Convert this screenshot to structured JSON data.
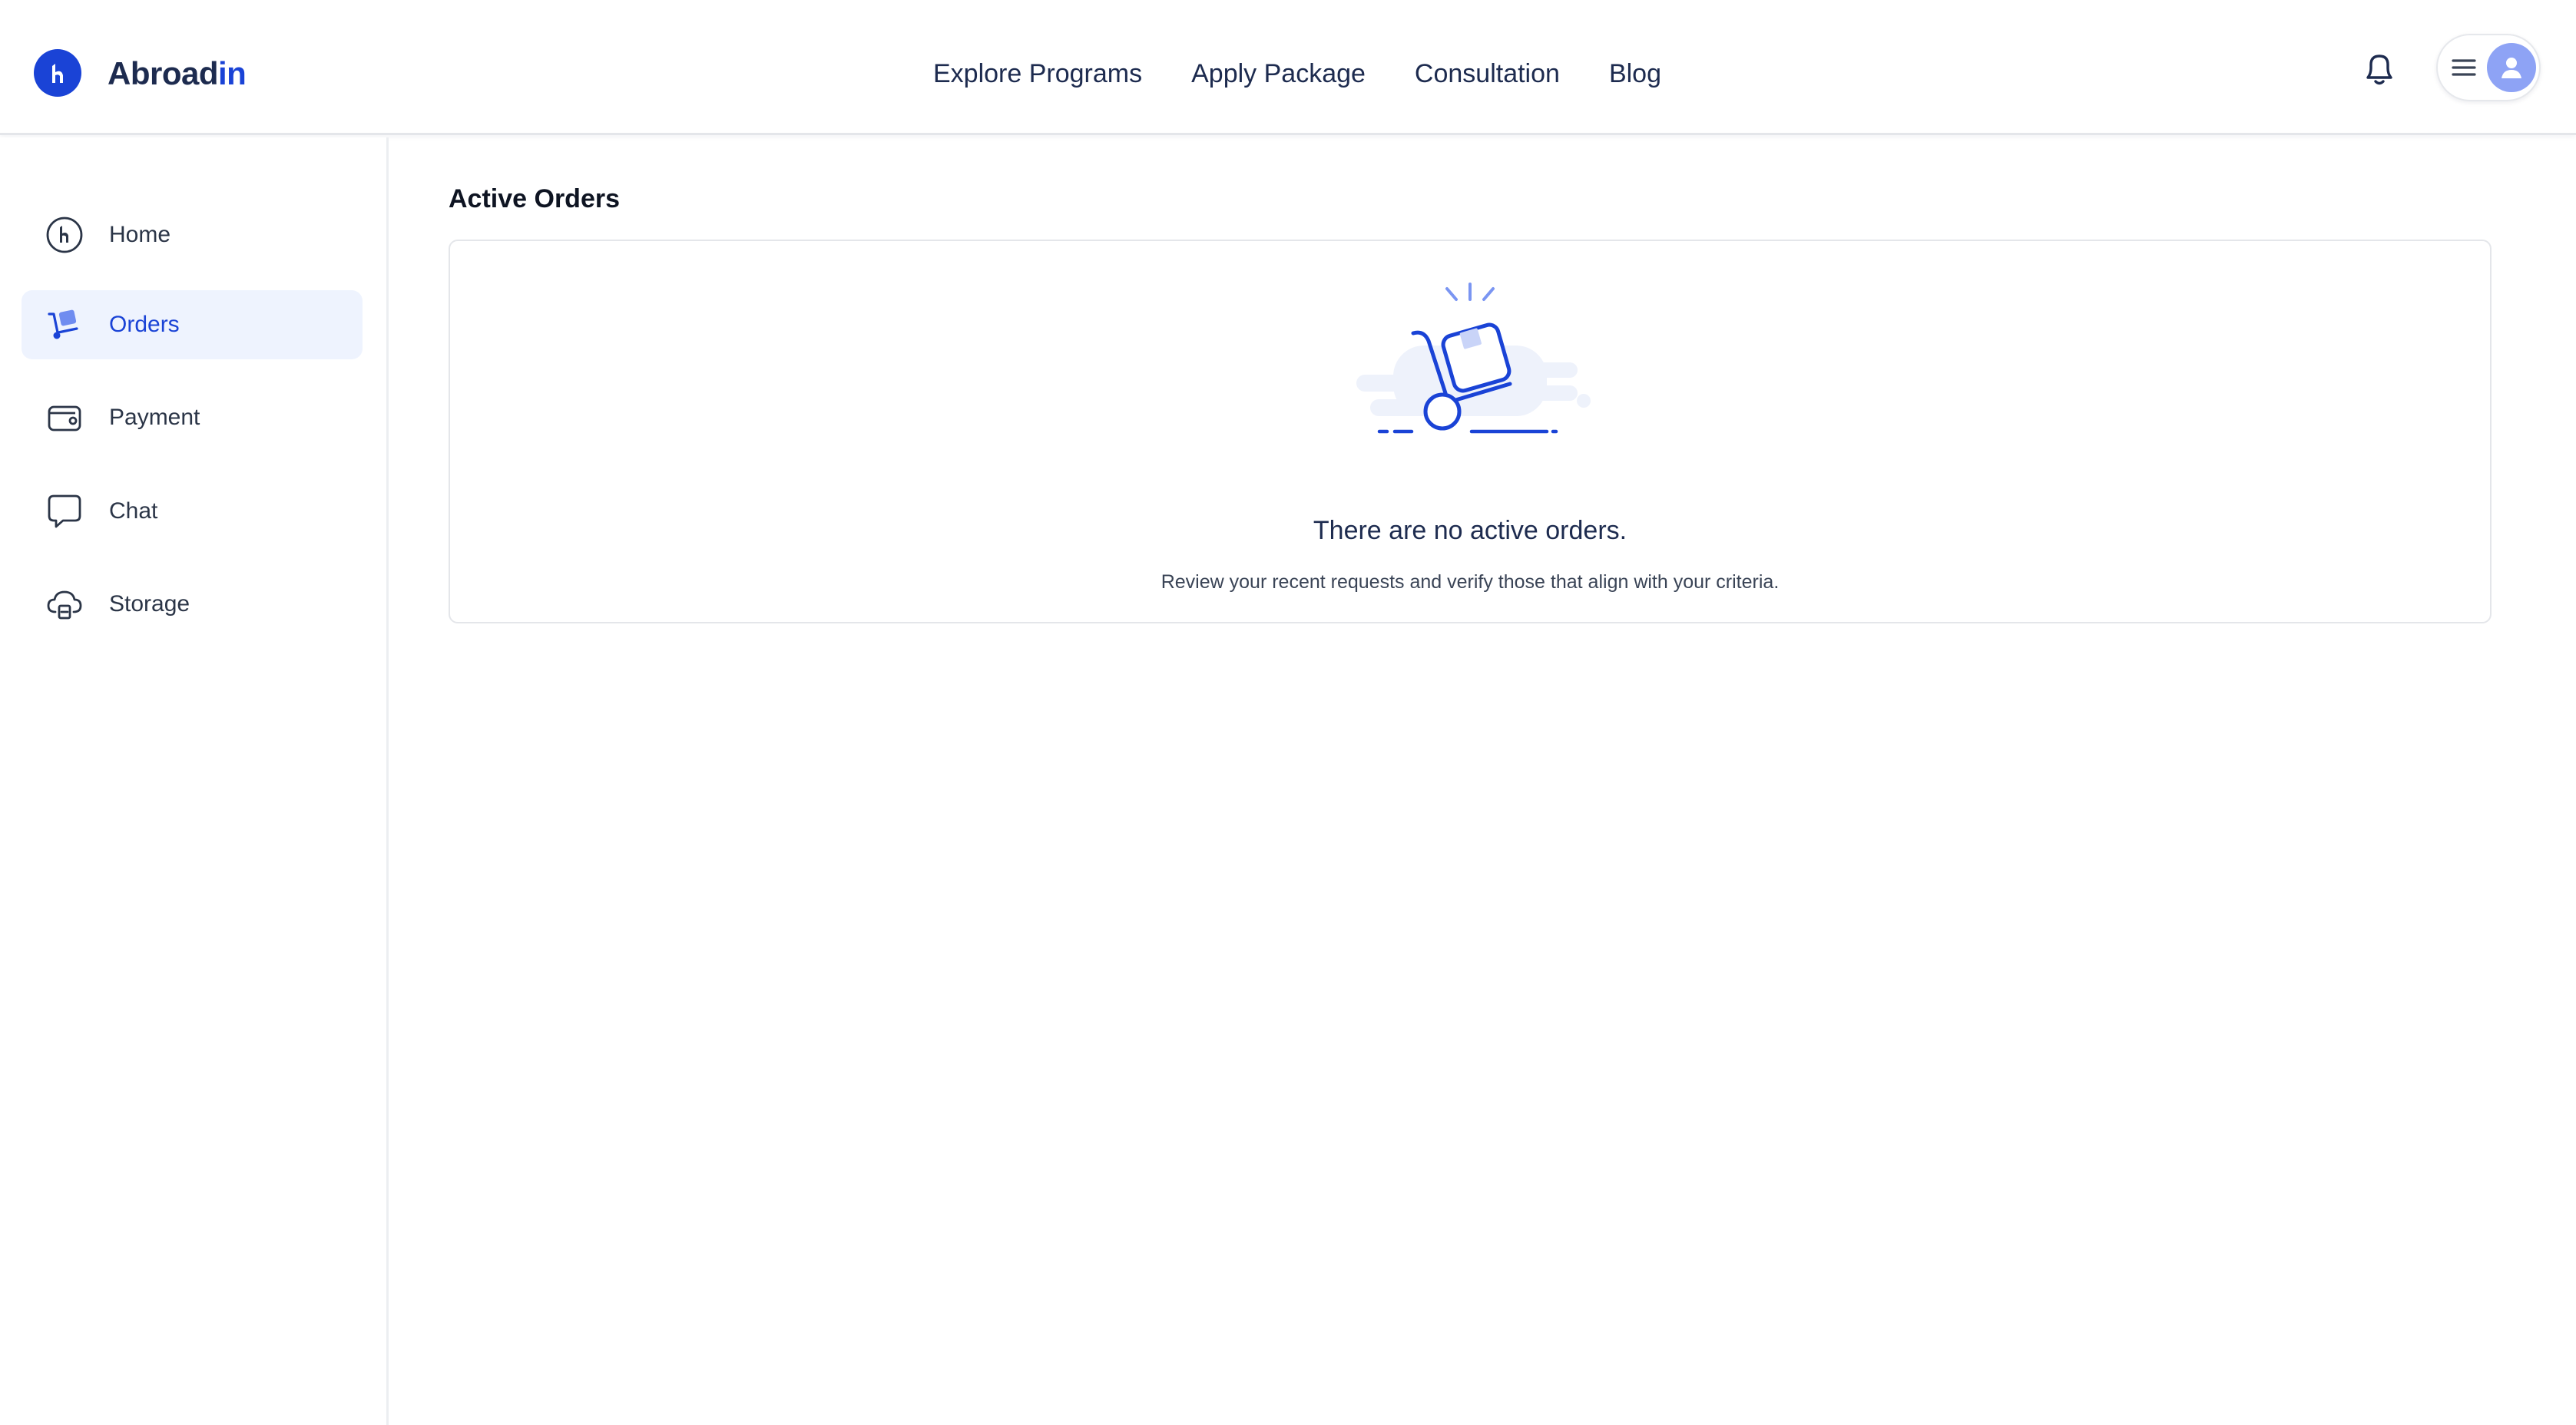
{
  "header": {
    "brand_part1": "Abroad",
    "brand_part2": "in",
    "nav": [
      "Explore Programs",
      "Apply Package",
      "Consultation",
      "Blog"
    ],
    "icons": {
      "logo": "logo-mark-icon",
      "notifications": "bell-icon",
      "menu": "hamburger-menu-icon",
      "avatar": "user-avatar-icon"
    }
  },
  "sidebar": {
    "items": [
      {
        "label": "Home",
        "icon": "home-logo-icon",
        "active": false
      },
      {
        "label": "Orders",
        "icon": "hand-truck-icon",
        "active": true
      },
      {
        "label": "Payment",
        "icon": "wallet-icon",
        "active": false
      },
      {
        "label": "Chat",
        "icon": "chat-bubble-icon",
        "active": false
      },
      {
        "label": "Storage",
        "icon": "cloud-storage-icon",
        "active": false
      }
    ]
  },
  "main": {
    "title": "Active Orders",
    "empty_state": {
      "title": "There are no active orders.",
      "subtitle": "Review your recent requests and verify those that align with your criteria.",
      "illustration": "hand-truck-package-illustration"
    }
  },
  "colors": {
    "accent": "#1a43d6",
    "accent_light": "#eef3fe",
    "avatar_bg": "#8ea3f5",
    "text_dark": "#1d2b4f",
    "border": "#e4e6ea"
  }
}
